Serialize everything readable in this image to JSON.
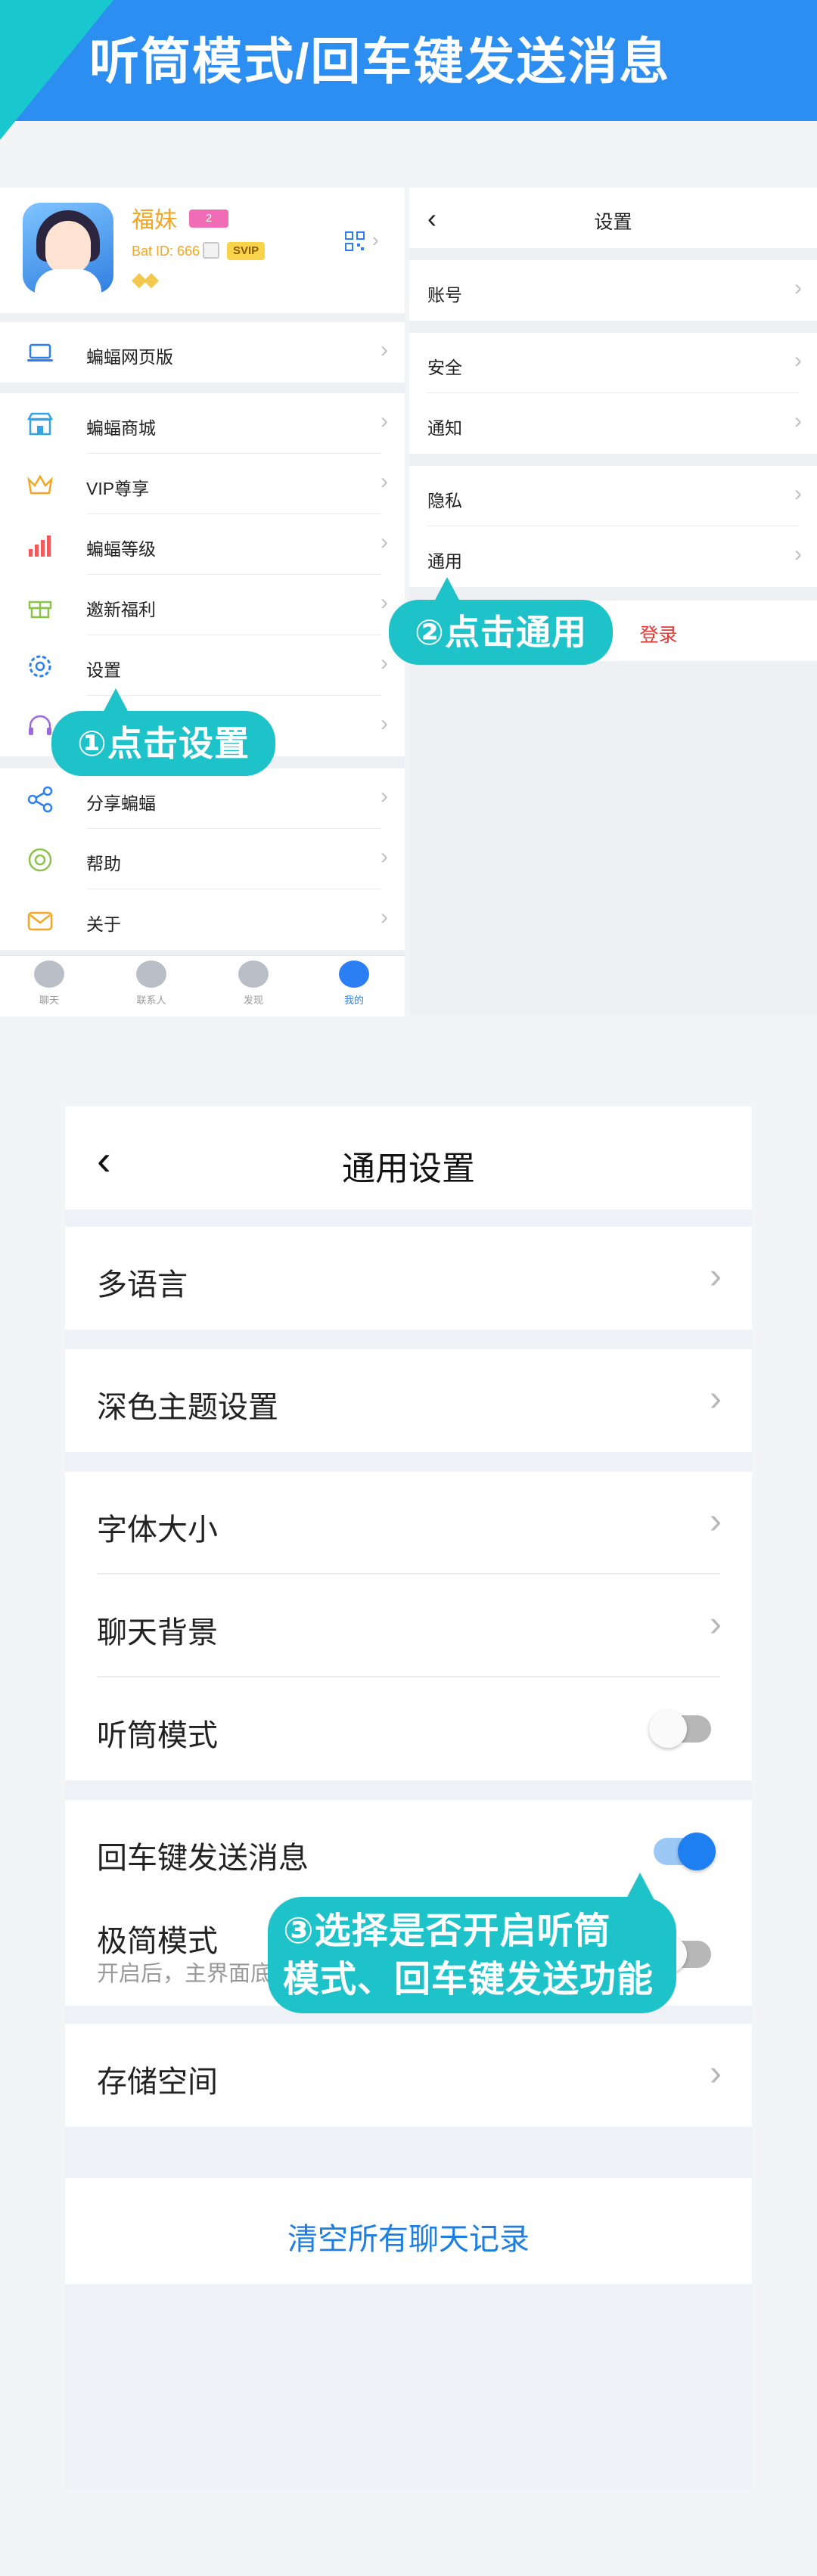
{
  "banner": {
    "title": "听筒模式/回车键发送消息"
  },
  "profile": {
    "name": "福妹",
    "badge": "2",
    "bat_id": "Bat ID: 666",
    "vip": "SVIP",
    "wings": "◆◆"
  },
  "left_menu": [
    {
      "label": "蝙蝠网页版",
      "icon": "laptop-icon"
    },
    {
      "label": "蝙蝠商城",
      "icon": "store-icon"
    },
    {
      "label": "VIP尊享",
      "icon": "crown-icon"
    },
    {
      "label": "蝙蝠等级",
      "icon": "level-chart-icon"
    },
    {
      "label": "邀新福利",
      "icon": "gift-icon"
    },
    {
      "label": "设置",
      "icon": "settings-gear-icon"
    },
    {
      "label": "",
      "icon": "headset-icon"
    },
    {
      "label": "分享蝙蝠",
      "icon": "share-icon"
    },
    {
      "label": "帮助",
      "icon": "help-icon"
    },
    {
      "label": "关于",
      "icon": "about-mail-icon"
    }
  ],
  "tabbar": [
    {
      "label": "聊天",
      "icon": "chat-icon"
    },
    {
      "label": "联系人",
      "icon": "contacts-icon"
    },
    {
      "label": "发现",
      "icon": "discover-planet-icon"
    },
    {
      "label": "我的",
      "icon": "me-person-icon"
    }
  ],
  "settings": {
    "title": "设置",
    "items": [
      "账号",
      "安全",
      "通知",
      "隐私",
      "通用"
    ],
    "logout": "登录"
  },
  "callouts": {
    "step1": "①点击设置",
    "step2": "②点击通用",
    "step3_line1": "③选择是否开启听筒",
    "step3_line2": "模式、回车键发送功能"
  },
  "general": {
    "title": "通用设置",
    "language": "多语言",
    "dark_theme": "深色主题设置",
    "font_size": "字体大小",
    "chat_bg": "聊天背景",
    "earpiece": "听筒模式",
    "enter_send": "回车键发送消息",
    "minimal": "极简模式",
    "minimal_sub": "开启后，主界面底",
    "storage": "存储空间",
    "clear_chats": "清空所有聊天记录",
    "toggles": {
      "earpiece": false,
      "enter_send": true,
      "minimal": false
    }
  },
  "colors": {
    "primary": "#2c8ef0",
    "callout": "#1ec3c9",
    "toggle_on": "#1e7ff0",
    "danger": "#e53935"
  }
}
